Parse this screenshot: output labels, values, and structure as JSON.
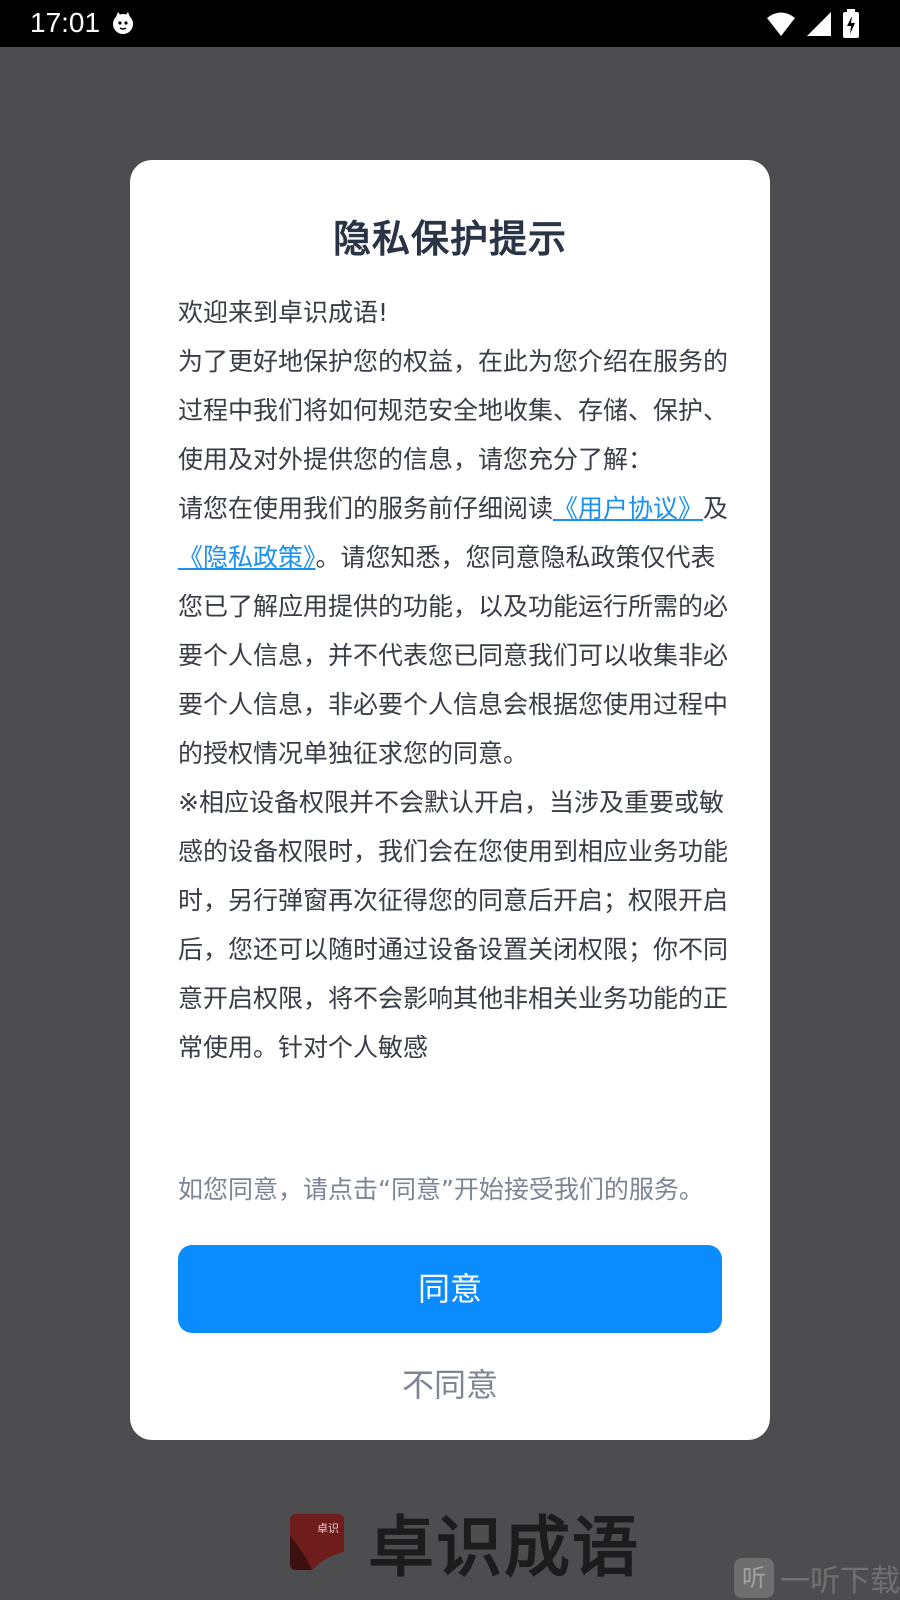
{
  "status_bar": {
    "time": "17:01"
  },
  "dialog": {
    "title": "隐私保护提示",
    "paragraphs": {
      "welcome": "欢迎来到卓识成语!",
      "intro": "为了更好地保护您的权益，在此为您介绍在服务的过程中我们将如何规范安全地收集、存储、保护、使用及对外提供您的信息，请您充分了解：",
      "read_prefix": "请您在使用我们的服务前仔细阅读",
      "user_agreement_link": "《用户协议》",
      "and_text": "及",
      "privacy_policy_link": "《隐私政策》",
      "read_suffix": "。请您知悉，您同意隐私政策仅代表您已了解应用提供的功能，以及功能运行所需的必要个人信息，并不代表您已同意我们可以收集非必要个人信息，非必要个人信息会根据您使用过程中的授权情况单独征求您的同意。",
      "permission_note": "※相应设备权限并不会默认开启，当涉及重要或敏感的设备权限时，我们会在您使用到相应业务功能时，另行弹窗再次征得您的同意后开启；权限开启后，您还可以随时通过设备设置关闭权限；你不同意开启权限，将不会影响其他非相关业务功能的正常使用。针对个人敏感"
    },
    "consent_text": "如您同意，请点击“同意”开始接受我们的服务。",
    "agree_label": "同意",
    "disagree_label": "不同意"
  },
  "brand": {
    "logo_text": "卓识",
    "name": "卓识成语"
  },
  "watermark": {
    "badge": "听",
    "text": "一听下载"
  },
  "colors": {
    "accent": "#0a8cff",
    "link": "#1a90f0",
    "overlay": "#4d4d4f"
  }
}
